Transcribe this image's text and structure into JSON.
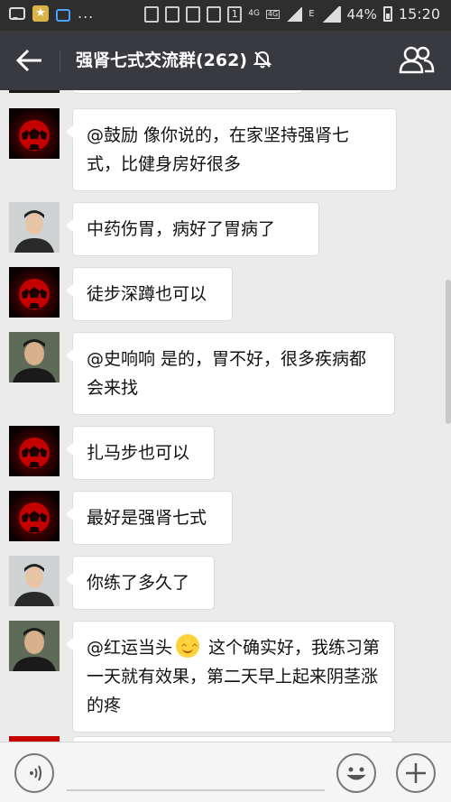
{
  "status_bar": {
    "network_4g": "4G",
    "network_4g2": "4G",
    "network_e": "E",
    "battery": "44%",
    "time": "15:20",
    "notif_count": "1"
  },
  "header": {
    "title": "强肾七式交流群(262)",
    "back_icon": "back-arrow-icon",
    "mute_icon": "bell-off-icon",
    "members_icon": "group-members-icon"
  },
  "messages": [
    {
      "avatar": "ball",
      "text": "@鼓励 像你说的，在家坚持强肾七式，比健身房好很多"
    },
    {
      "avatar": "man-young",
      "text": "中药伤胃，病好了胃病了"
    },
    {
      "avatar": "ball",
      "text": "徒步深蹲也可以"
    },
    {
      "avatar": "man-dark",
      "text": "@史响响 是的，胃不好，很多疾病都会来找"
    },
    {
      "avatar": "ball",
      "text": "扎马步也可以"
    },
    {
      "avatar": "ball",
      "text": "最好是强肾七式"
    },
    {
      "avatar": "man-young",
      "text": "你练了多久了"
    },
    {
      "avatar": "man-dark",
      "text_before_emoji": "@红运当头",
      "emoji": "smile-emoji",
      "text_after_emoji": " 这个确实好，我练习第一天就有效果，第二天早上起来阴茎涨的疼"
    }
  ],
  "input_bar": {
    "voice_icon": "voice-icon",
    "emoji_icon": "emoji-icon",
    "plus_icon": "plus-icon"
  }
}
